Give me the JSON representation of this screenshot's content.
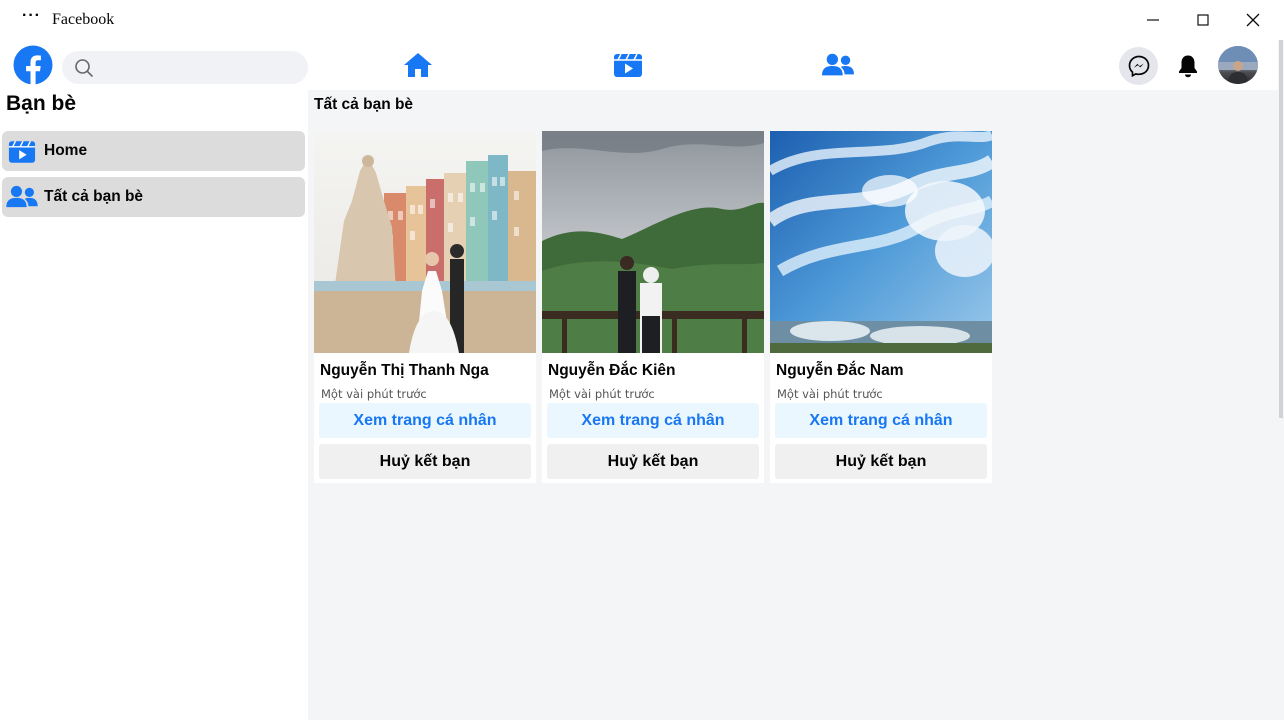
{
  "window": {
    "menu_label": "···",
    "title": "Facebook"
  },
  "navbar": {
    "search_placeholder": "",
    "nav_items": [
      "home-icon",
      "video-icon",
      "friends-icon"
    ]
  },
  "sidebar": {
    "title": "Bạn bè",
    "items": [
      {
        "label": "Home",
        "icon": "video-icon"
      },
      {
        "label": "Tất cả bạn bè",
        "icon": "friends-icon"
      }
    ]
  },
  "main": {
    "title": "Tất cả bạn bè",
    "friends": [
      {
        "name": "Nguyễn Thị Thanh Nga",
        "time": "Một vài phút trước",
        "profile_label": "Xem trang cá nhân",
        "unfriend_label": "Huỷ kết bạn"
      },
      {
        "name": "Nguyễn Đắc Kiên",
        "time": "Một vài phút trước",
        "profile_label": "Xem trang cá nhân",
        "unfriend_label": "Huỷ kết bạn"
      },
      {
        "name": "Nguyễn Đắc Nam",
        "time": "Một vài phút trước",
        "profile_label": "Xem trang cá nhân",
        "unfriend_label": "Huỷ kết bạn"
      }
    ]
  },
  "colors": {
    "brand": "#1877f2",
    "profile_button_bg": "#ebf7fe",
    "sidebar_item_bg": "#dcdcdc",
    "main_bg": "#f4f5f7"
  }
}
